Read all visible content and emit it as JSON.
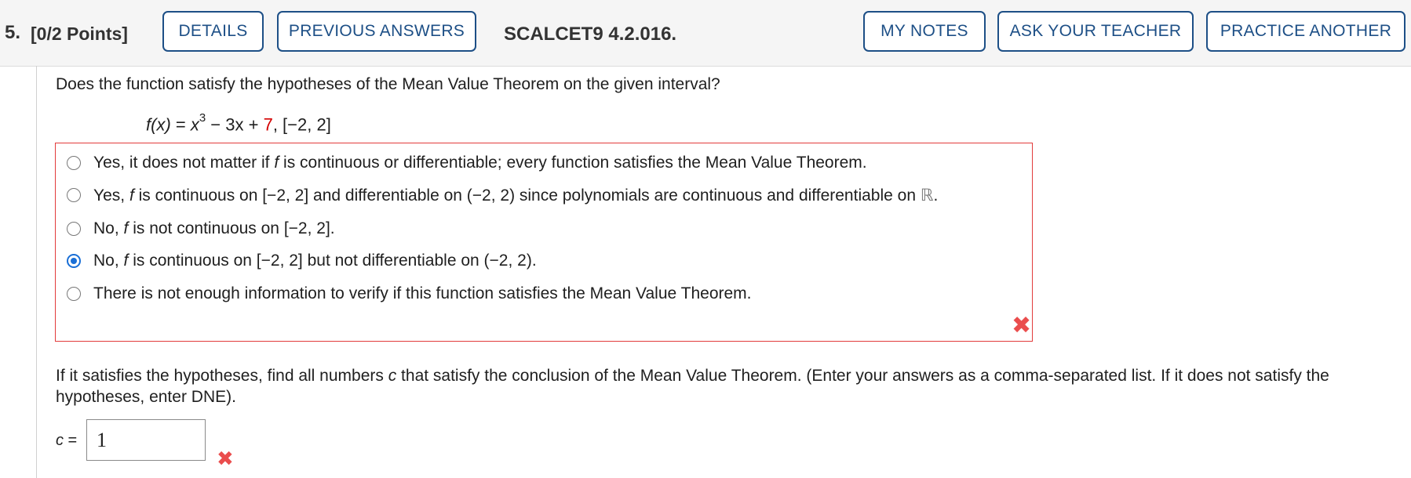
{
  "header": {
    "question_number": "5.",
    "points": "[0/2 Points]",
    "details_label": "DETAILS",
    "previous_answers_label": "PREVIOUS ANSWERS",
    "question_id": "SCALCET9 4.2.016.",
    "my_notes_label": "MY NOTES",
    "ask_teacher_label": "ASK YOUR TEACHER",
    "practice_another_label": "PRACTICE ANOTHER"
  },
  "question": {
    "prompt": "Does the function satisfy the hypotheses of the Mean Value Theorem on the given interval?",
    "formula": {
      "fx": "f(x)",
      "equals": " = ",
      "x": "x",
      "exponent": "3",
      "middle": " − 3x + ",
      "constant": "7",
      "interval": ",   [−2, 2]"
    },
    "choices": [
      {
        "prefix": "Yes, it does not matter if ",
        "f": "f",
        "suffix": " is continuous or differentiable; every function satisfies the Mean Value Theorem.",
        "selected": false
      },
      {
        "prefix": "Yes, ",
        "f": "f",
        "suffix": " is continuous on [−2, 2] and differentiable on (−2, 2) since polynomials are continuous and differentiable on ",
        "reals": "ℝ",
        "end": ".",
        "selected": false
      },
      {
        "prefix": "No, ",
        "f": "f",
        "suffix": " is not continuous on [−2, 2].",
        "selected": false
      },
      {
        "prefix": "No, ",
        "f": "f",
        "suffix": " is continuous on [−2, 2] but not differentiable on (−2, 2).",
        "selected": true
      },
      {
        "prefix": "There is not enough information to verify if this function satisfies the Mean Value Theorem.",
        "f": "",
        "suffix": "",
        "selected": false
      }
    ],
    "choice_status_icon": "incorrect-x-icon"
  },
  "part2": {
    "text_before": "If it satisfies the hypotheses, find all numbers ",
    "c": "c",
    "text_after": " that satisfy the conclusion of the Mean Value Theorem. (Enter your answers as a comma-separated list. If it does not satisfy the hypotheses, enter DNE).",
    "c_label": "c =",
    "c_value": "1",
    "status_icon": "incorrect-x-icon"
  },
  "colors": {
    "accent": "#1d4f86",
    "error": "#e23b3b",
    "radio_selected": "#1a6fd6"
  }
}
